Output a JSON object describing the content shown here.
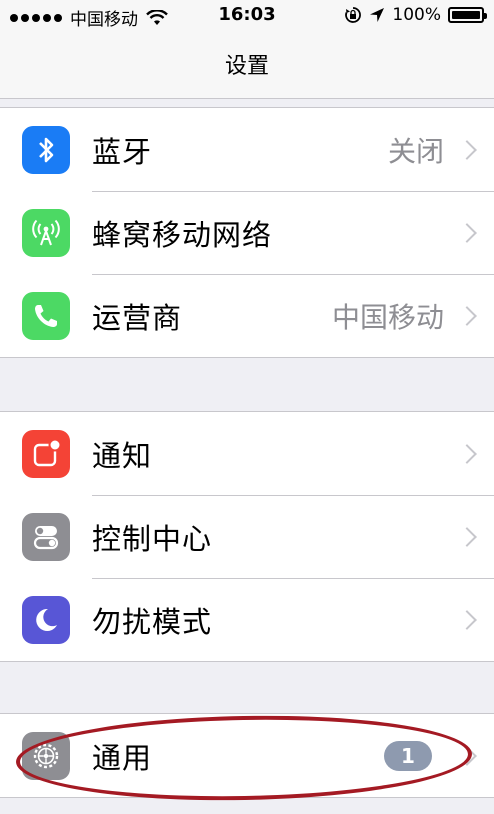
{
  "status_bar": {
    "carrier": "中国移动",
    "time": "16:03",
    "battery_percent": "100%",
    "battery_level": 1.0,
    "icons": [
      "signal-dots-icon",
      "wifi-icon",
      "rotation-lock-icon",
      "location-arrow-icon",
      "battery-icon"
    ]
  },
  "nav": {
    "title": "设置"
  },
  "groups": [
    {
      "rows": [
        {
          "label": "蓝牙",
          "value": "关闭",
          "icon": "bluetooth-icon",
          "icon_bg": "#1a7cf5"
        },
        {
          "label": "蜂窝移动网络",
          "value": "",
          "icon": "cellular-antenna-icon",
          "icon_bg": "#4cd964"
        },
        {
          "label": "运营商",
          "value": "中国移动",
          "icon": "phone-icon",
          "icon_bg": "#4cd964"
        }
      ]
    },
    {
      "rows": [
        {
          "label": "通知",
          "value": "",
          "icon": "notifications-icon",
          "icon_bg": "#f44336"
        },
        {
          "label": "控制中心",
          "value": "",
          "icon": "control-center-icon",
          "icon_bg": "#8e8e93"
        },
        {
          "label": "勿扰模式",
          "value": "",
          "icon": "moon-icon",
          "icon_bg": "#5856d6"
        }
      ]
    },
    {
      "rows": [
        {
          "label": "通用",
          "badge": "1",
          "icon": "gear-icon",
          "icon_bg": "#8e8e93"
        }
      ]
    }
  ],
  "annotation_color": "#a41a23"
}
